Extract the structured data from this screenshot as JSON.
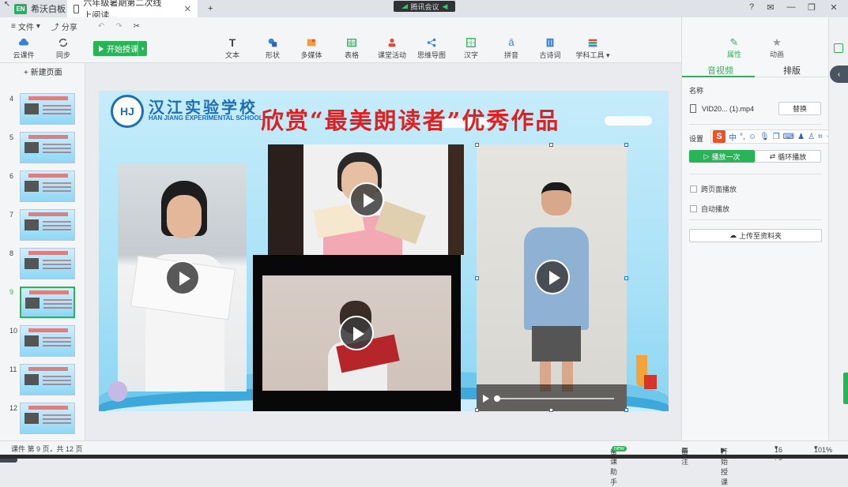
{
  "titlebar": {
    "app_tab": "希沃白板",
    "doc_tab": "六年级暑期第二次线上阅读...",
    "meeting": "腾讯会议"
  },
  "menu": {
    "file": "文件",
    "share": "分享"
  },
  "toolbar": {
    "cloud": "云课件",
    "sync": "同步",
    "start_teaching": "开始授课",
    "items": [
      "文本",
      "形状",
      "多媒体",
      "表格",
      "课堂活动",
      "思维导图",
      "汉字",
      "拼音",
      "古诗词",
      "学科工具"
    ]
  },
  "left_panel": {
    "new_page": "+ 新建页面",
    "pages": [
      "4",
      "5",
      "6",
      "7",
      "8",
      "9",
      "10",
      "11",
      "12"
    ],
    "selected_page": "9"
  },
  "slide": {
    "school_cn": "汉江实验学校",
    "school_en": "HAN JIANG EXPERIMENTAL SCHOOL",
    "title": "欣赏“最美朗读者”优秀作品"
  },
  "right_panel": {
    "tab_properties": "属性",
    "tab_animation": "动画",
    "subtab_av": "音视频",
    "subtab_arrange": "排版",
    "name_label": "名称",
    "file_name": "VID20... (1).mp4",
    "replace": "替换",
    "settings_label": "设置",
    "play_once": "播放一次",
    "loop_play": "循环播放",
    "cross_page": "跨页面播放",
    "autoplay": "自动播放",
    "upload": "上传至资料夹"
  },
  "ime": {
    "lang": "中",
    "punct": "°,"
  },
  "status": {
    "page_info": "课件 第 9 页，共 12 页",
    "assistant": "备课助手",
    "new_badge": "new",
    "notes": "备注",
    "start": "开始授课",
    "ratio": "16 : 9",
    "zoom": "101%"
  }
}
